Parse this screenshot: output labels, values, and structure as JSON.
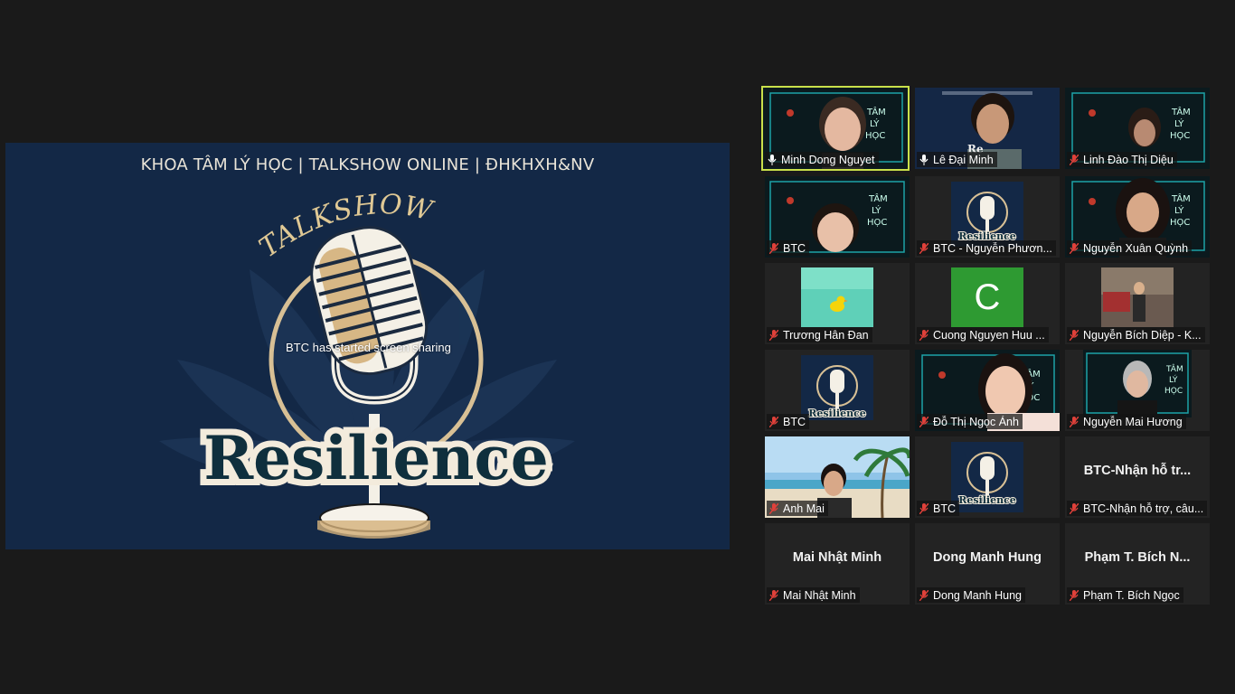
{
  "shared_screen": {
    "header": "KHOA TÂM LÝ HỌC  |  TALKSHOW ONLINE  |  ĐHKHXH&NV",
    "arc_text": "TALKSHOW",
    "title": "Resilience",
    "status": "BTC has started screen sharing"
  },
  "colors": {
    "background": "#1a1a1a",
    "slide_background": "#132846",
    "active_speaker_border": "#c9e04a",
    "muted_mic": "#e0413a",
    "teal_glow": "#20c5c9"
  },
  "participants": [
    {
      "name": "Minh Dong Nguyet",
      "mic": "unmuted",
      "active": true
    },
    {
      "name": "Lê Đại Minh",
      "mic": "unmuted"
    },
    {
      "name": "Linh Đào Thị Diệu",
      "mic": "muted"
    },
    {
      "name": "BTC",
      "mic": "muted"
    },
    {
      "name": "BTC - Nguyễn Phươn...",
      "mic": "muted"
    },
    {
      "name": "Nguyễn Xuân Quỳnh",
      "mic": "muted"
    },
    {
      "name": "Trương Hân Đan",
      "mic": "muted"
    },
    {
      "name": "Cuong Nguyen Huu ...",
      "mic": "muted",
      "avatar_letter": "C"
    },
    {
      "name": "Nguyễn Bích Diệp - K...",
      "mic": "muted"
    },
    {
      "name": "BTC",
      "mic": "muted"
    },
    {
      "name": "Đỗ Thị Ngọc Ánh",
      "mic": "muted"
    },
    {
      "name": "Nguyễn Mai Hương",
      "mic": "muted"
    },
    {
      "name": "Anh Mai",
      "mic": "muted"
    },
    {
      "name": "BTC",
      "mic": "muted"
    },
    {
      "name": "BTC-Nhận hỗ trợ, câu...",
      "mic": "muted",
      "display_name": "BTC-Nhận hỗ tr..."
    },
    {
      "name": "Mai Nhật Minh",
      "mic": "muted",
      "display_name": "Mai Nhật Minh"
    },
    {
      "name": "Dong Manh Hung",
      "mic": "muted",
      "display_name": "Dong Manh Hung"
    },
    {
      "name": "Phạm T. Bích Ngọc",
      "mic": "muted",
      "display_name": "Phạm T. Bích N..."
    }
  ],
  "icons": {
    "muted": "mic-muted-icon",
    "unmuted": "mic-icon",
    "cursor": "mouse-cursor-icon"
  }
}
